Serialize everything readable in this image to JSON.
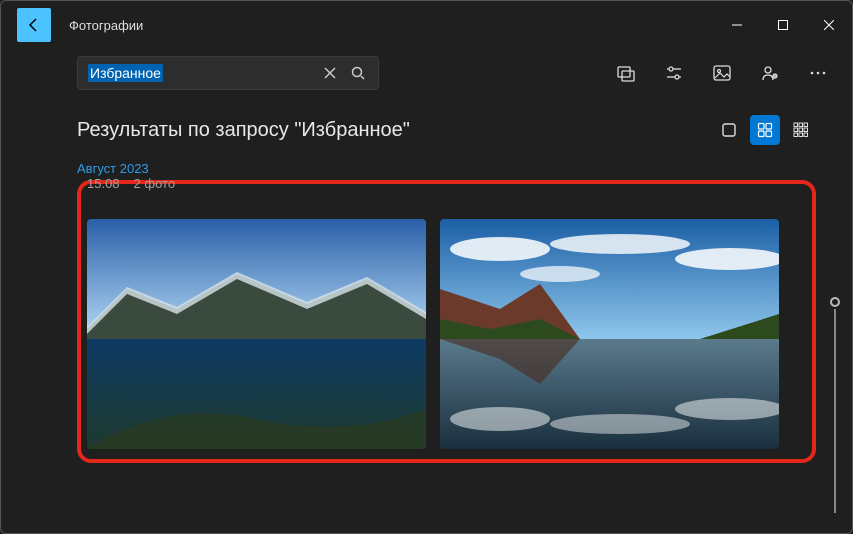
{
  "appTitle": "Фотографии",
  "search": {
    "value": "Избранное"
  },
  "heading": "Результаты по запросу \"Избранное\"",
  "monthLabel": "Август 2023",
  "dateLabel": "15.08",
  "countLabel": "2 фото"
}
